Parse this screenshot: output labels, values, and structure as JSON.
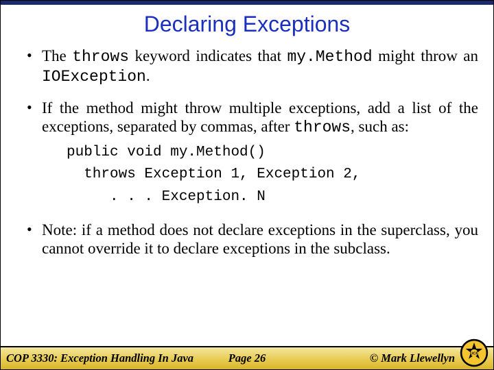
{
  "title": "Declaring Exceptions",
  "bullets": {
    "b1": {
      "t1": "The ",
      "code1": "throws",
      "t2": " keyword indicates that ",
      "code2": "my.Method",
      "t3": " might throw an ",
      "code3": "IOException",
      "t4": "."
    },
    "b2": {
      "t1": "If the method might throw multiple exceptions, add a list of the exceptions, separated by commas, after ",
      "code1": "throws",
      "t2": ", such as:"
    },
    "code": {
      "l1": "public void my.Method()",
      "l2": "  throws Exception 1, Exception 2,",
      "l3": "     . . . Exception. N"
    },
    "b3": {
      "t1": "Note: if a method does not declare exceptions in the superclass, you cannot override it to declare exceptions in the subclass."
    }
  },
  "footer": {
    "course": "COP 3330:  Exception Handling In Java",
    "page": "Page 26",
    "copyright": "© Mark Llewellyn"
  }
}
